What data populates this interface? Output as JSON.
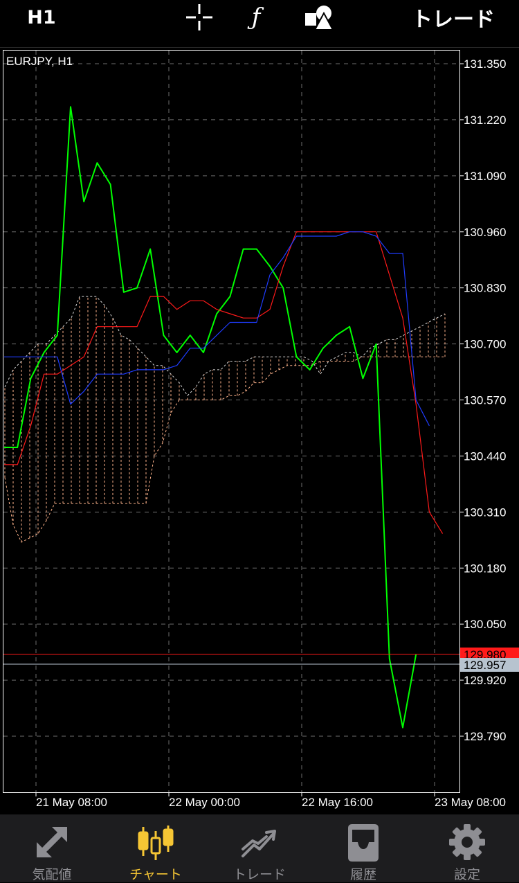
{
  "toolbar": {
    "timeframe": "H1",
    "crosshair_icon": "crosshair-icon",
    "indicators_icon": "function-icon",
    "objects_icon": "shapes-icon",
    "trade_label": "トレード"
  },
  "chart": {
    "symbol_label": "EURJPY, H1",
    "price_labels": [
      "131.350",
      "131.220",
      "131.090",
      "130.960",
      "130.830",
      "130.700",
      "130.570",
      "130.440",
      "130.310",
      "130.180",
      "130.050",
      "129.920",
      "129.790"
    ],
    "time_labels": [
      "21 May 08:00",
      "22 May 00:00",
      "22 May 16:00",
      "23 May 08:00"
    ],
    "ask_price": "129.980",
    "bid_price": "129.957",
    "ask_color": "#ff1a1a",
    "bid_color": "#b7c3cf",
    "grid_color": "#6e6e6e",
    "axis_color": "#ffffff",
    "indicator_colors": {
      "chikou": "#00ff00",
      "tenkan": "#ff1a1a",
      "kijun": "#1f3cff",
      "cloud": "#ffb48c"
    }
  },
  "chart_data": {
    "type": "line",
    "title": "EURJPY, H1",
    "ylim": [
      129.66,
      131.38
    ],
    "x": [
      "21 May 08:00",
      "22 May 00:00",
      "22 May 16:00",
      "23 May 08:00"
    ],
    "series": [
      {
        "values": [
          130.46,
          130.46,
          130.62,
          130.68,
          130.72,
          131.25,
          131.03,
          131.12,
          131.07,
          130.82,
          130.83,
          130.92,
          130.72,
          130.68,
          130.72,
          130.68,
          130.77,
          130.81,
          130.92,
          130.92,
          130.88,
          130.83,
          130.67,
          130.64,
          130.69,
          130.72,
          130.74,
          130.62,
          130.7,
          129.97,
          129.81,
          129.98
        ]
      },
      {
        "values": [
          130.42,
          130.42,
          130.51,
          130.63,
          130.63,
          130.65,
          130.67,
          130.74,
          130.74,
          130.74,
          130.74,
          130.81,
          130.81,
          130.78,
          130.8,
          130.8,
          130.78,
          130.77,
          130.76,
          130.76,
          130.78,
          130.88,
          130.96,
          130.96,
          130.96,
          130.96,
          130.96,
          130.96,
          130.96,
          130.86,
          130.76,
          130.56,
          130.31,
          130.26
        ]
      },
      {
        "values": [
          130.67,
          130.67,
          130.67,
          130.67,
          130.67,
          130.56,
          130.59,
          130.63,
          130.63,
          130.63,
          130.64,
          130.64,
          130.64,
          130.65,
          130.69,
          130.69,
          130.72,
          130.75,
          130.75,
          130.75,
          130.86,
          130.9,
          130.95,
          130.95,
          130.95,
          130.95,
          130.96,
          130.96,
          130.95,
          130.91,
          130.91,
          130.57,
          130.51
        ]
      }
    ]
  },
  "nav": [
    {
      "label": "気配値",
      "icon": "quotes-arrows-icon",
      "active": false
    },
    {
      "label": "チャート",
      "icon": "candlestick-icon",
      "active": true
    },
    {
      "label": "トレード",
      "icon": "trade-chart-icon",
      "active": false
    },
    {
      "label": "履歴",
      "icon": "history-inbox-icon",
      "active": false
    },
    {
      "label": "設定",
      "icon": "gear-icon",
      "active": false
    }
  ]
}
